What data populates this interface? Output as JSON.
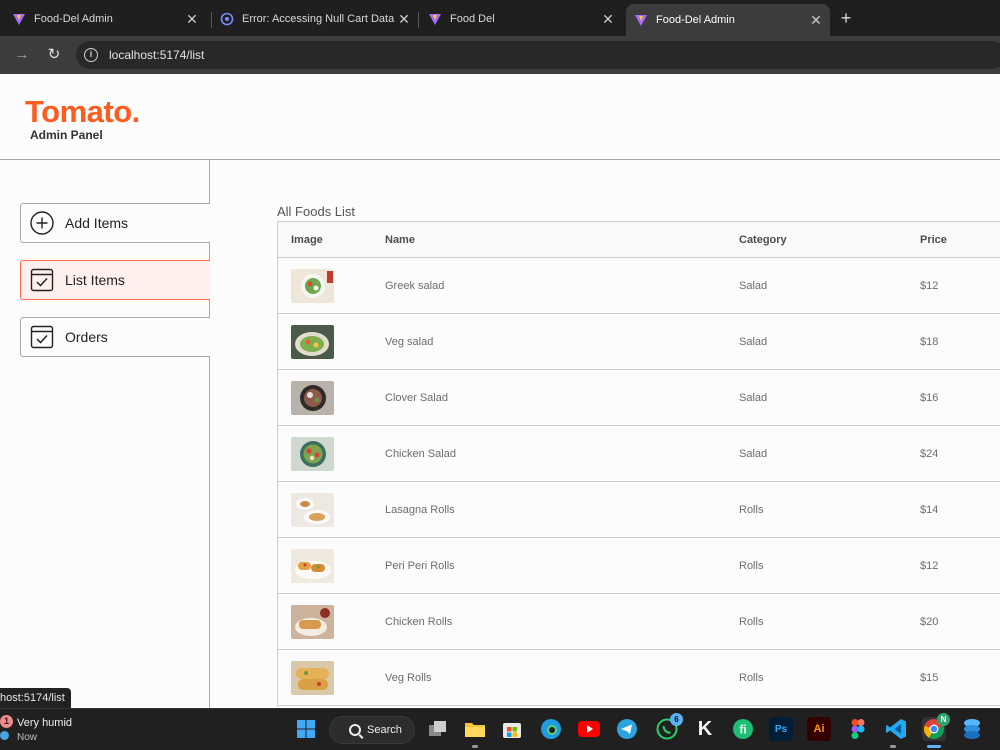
{
  "browser": {
    "tabs": [
      {
        "title": "Food-Del Admin",
        "active": false
      },
      {
        "title": "Error: Accessing Null Cart Data",
        "active": false
      },
      {
        "title": "Food Del",
        "active": false
      },
      {
        "title": "Food-Del Admin",
        "active": true
      }
    ],
    "new_tab_label": "+",
    "address": "localhost:5174/list",
    "status_url": "host:5174/list"
  },
  "app": {
    "logo": "Tomato.",
    "logo_subtitle": "Admin Panel",
    "sidebar": [
      {
        "label": "Add Items",
        "icon": "add-circle-icon",
        "active": false
      },
      {
        "label": "List Items",
        "icon": "checklist-icon",
        "active": true
      },
      {
        "label": "Orders",
        "icon": "checklist-icon",
        "active": false
      }
    ],
    "list": {
      "title": "All Foods List",
      "headers": {
        "image": "Image",
        "name": "Name",
        "category": "Category",
        "price": "Price"
      },
      "rows": [
        {
          "name": "Greek salad",
          "category": "Salad",
          "price": "$12"
        },
        {
          "name": "Veg salad",
          "category": "Salad",
          "price": "$18"
        },
        {
          "name": "Clover Salad",
          "category": "Salad",
          "price": "$16"
        },
        {
          "name": "Chicken Salad",
          "category": "Salad",
          "price": "$24"
        },
        {
          "name": "Lasagna Rolls",
          "category": "Rolls",
          "price": "$14"
        },
        {
          "name": "Peri Peri Rolls",
          "category": "Rolls",
          "price": "$12"
        },
        {
          "name": "Chicken Rolls",
          "category": "Rolls",
          "price": "$20"
        },
        {
          "name": "Veg Rolls",
          "category": "Rolls",
          "price": "$15"
        }
      ]
    }
  },
  "taskbar": {
    "weather_badge": "1",
    "weather_text": "Very humid",
    "weather_subtext": "Now",
    "search_label": "Search",
    "whatsapp_badge": "6",
    "chrome_badge": "N",
    "apps": [
      "windows-start",
      "search",
      "task-view",
      "file-explorer",
      "microsoft-store",
      "edge",
      "youtube",
      "telegram",
      "whatsapp",
      "k-app",
      "fiverr",
      "photoshop",
      "illustrator",
      "figma",
      "vscode",
      "chrome",
      "stack-app"
    ]
  },
  "colors": {
    "brand": "#fd5b1f",
    "active_bg": "#fff0ed",
    "active_border": "#ff6b4a"
  }
}
